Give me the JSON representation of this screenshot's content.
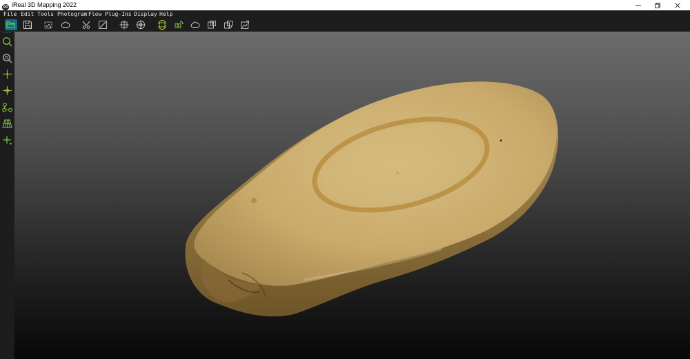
{
  "window": {
    "title": "iReal 3D Mapping 2022",
    "controls": [
      "minimize-icon",
      "restore-icon",
      "close-icon"
    ]
  },
  "menu": {
    "items": [
      "File",
      "Edit",
      "Tools",
      "Photogram",
      "Flow",
      "Plug-Ins",
      "Display",
      "Help"
    ]
  },
  "toolbar": {
    "tools": [
      "open-folder-icon",
      "save-icon",
      "select-region-icon",
      "point-cloud-icon",
      "filter-icon",
      "edit-mesh-icon",
      "target-icon",
      "crosshair-icon",
      "auto-process-icon",
      "camera-align-icon",
      "cloud-upload-icon",
      "photo-export-icon",
      "photo-sync-icon",
      "texture-export-icon"
    ],
    "active_tool": "open-folder-icon"
  },
  "left_panel": {
    "tools": [
      "zoom-icon",
      "zoom-fit-icon",
      "add-point-icon",
      "pick-point-icon",
      "connect-points-icon",
      "grid-icon",
      "move-axis-icon"
    ]
  },
  "viewport": {
    "content": "textured-3d-model-icon",
    "colors": {
      "model_base": "#c6a765",
      "model_ring": "#b58a3a",
      "bg_top": "#6c6c6c",
      "bg_bottom": "#070707"
    }
  }
}
